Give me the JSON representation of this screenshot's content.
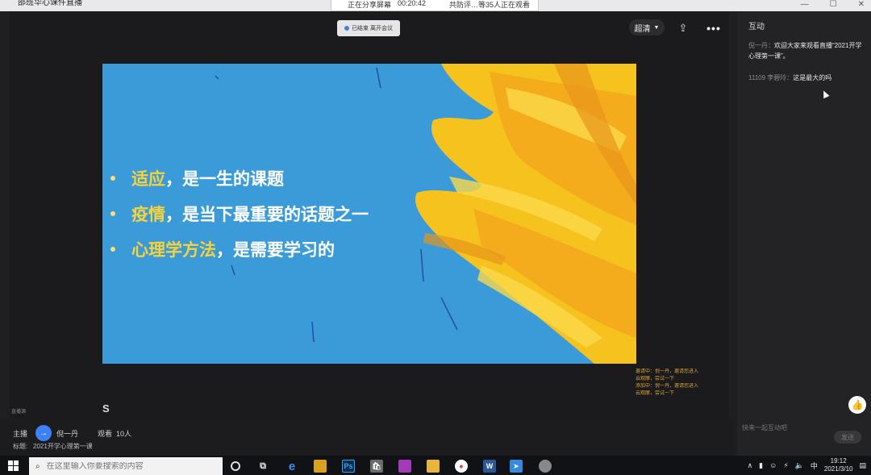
{
  "window": {
    "title": "邵班华心课件直播",
    "share_status": "正在分享屏幕",
    "timer": "00:20:42",
    "share_note": "共防评…等35人正在观看"
  },
  "player": {
    "leave_label": "已结束 离开会议",
    "quality_label": "超清",
    "share_icon": "share-icon",
    "more_label": "•••",
    "slide": {
      "bullets": [
        {
          "highlight": "适应",
          "rest": "，是一生的课题"
        },
        {
          "highlight": "疫情",
          "rest": "，是当下最重要的话题之一"
        },
        {
          "highlight": "心理学方法",
          "rest": "，是需要学习的"
        }
      ],
      "colors": {
        "background": "#3b9bd9",
        "paint": "#f6c21e",
        "highlight": "#f6d23c"
      }
    },
    "watermark": "直播源",
    "danmu": [
      "邀请中：倪一丹，邀请您进入",
      "云观摩，尝试一下",
      "添加中：倪一丹，邀请您进入",
      "云观摩，尝试一下"
    ]
  },
  "host": {
    "host_label": "主播",
    "host_name": "倪一丹",
    "viewers_label": "观看",
    "viewers_count": "10人",
    "topic_label": "标题:",
    "topic": "2021开学心理第一课"
  },
  "sidebar": {
    "title": "互动",
    "messages": [
      {
        "user": "倪一丹：",
        "text": "欢迎大家来观看直播“2021开学心理第一课”。"
      },
      {
        "user": "11109 李碧玲：",
        "text": "这是最大的吗"
      }
    ],
    "input_placeholder": "快来一起互动吧",
    "send_label": "发送",
    "like_icon": "thumbs-up-icon"
  },
  "taskbar": {
    "search_placeholder": "在这里输入你要搜索的内容",
    "apps": [
      "cortana-icon",
      "task-view-icon",
      "edge-icon",
      "app-icon",
      "photoshop-icon",
      "store-icon",
      "media-icon",
      "file-explorer-icon",
      "chrome-icon",
      "word-icon",
      "live-app-icon",
      "app2-icon"
    ],
    "ime": "中",
    "time": "19:12",
    "date": "2021/3/10"
  }
}
